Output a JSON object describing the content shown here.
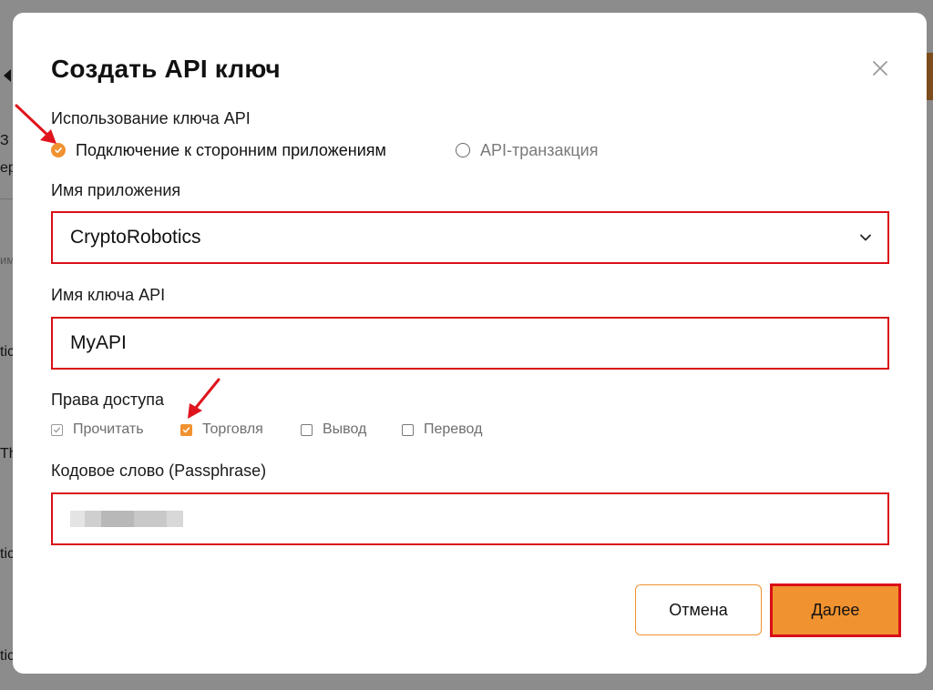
{
  "background": {
    "fragments": [
      "З",
      "ер",
      "име",
      "tic",
      "Th",
      "tic",
      "tic"
    ]
  },
  "dialog": {
    "title": "Создать API ключ",
    "close_icon": "close-icon",
    "key_usage": {
      "label": "Использование ключа API",
      "options": [
        {
          "label": "Подключение к сторонним приложениям",
          "selected": true
        },
        {
          "label": "API-транзакция",
          "selected": false
        }
      ]
    },
    "app_name": {
      "label": "Имя приложения",
      "value": "CryptoRobotics"
    },
    "api_key_name": {
      "label": "Имя ключа API",
      "value": "MyAPI"
    },
    "permissions": {
      "label": "Права доступа",
      "items": [
        {
          "label": "Прочитать",
          "checked": true,
          "disabled": true
        },
        {
          "label": "Торговля",
          "checked": true,
          "disabled": false
        },
        {
          "label": "Вывод",
          "checked": false,
          "disabled": false
        },
        {
          "label": "Перевод",
          "checked": false,
          "disabled": false
        }
      ]
    },
    "passphrase": {
      "label": "Кодовое слово (Passphrase)"
    },
    "buttons": {
      "cancel": "Отмена",
      "next": "Далее"
    }
  },
  "colors": {
    "accent": "#f0922f",
    "highlight": "#d90f18"
  }
}
